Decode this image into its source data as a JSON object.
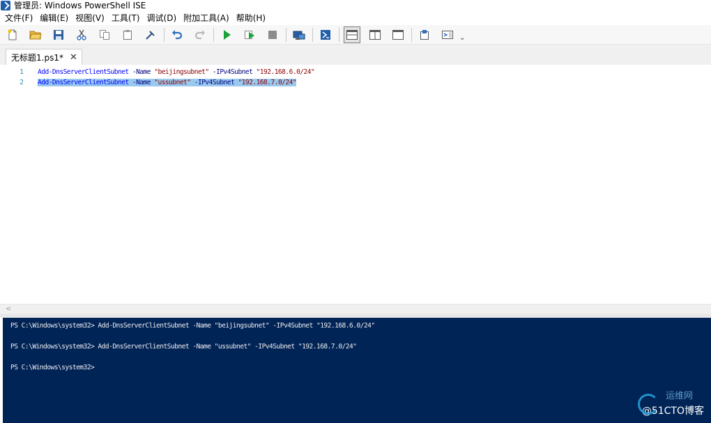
{
  "window": {
    "title": "管理员: Windows PowerShell ISE",
    "icon": "powershell-ise-icon"
  },
  "menu": [
    {
      "label": "文件(F)"
    },
    {
      "label": "编辑(E)"
    },
    {
      "label": "视图(V)"
    },
    {
      "label": "工具(T)"
    },
    {
      "label": "调试(D)"
    },
    {
      "label": "附加工具(A)"
    },
    {
      "label": "帮助(H)"
    }
  ],
  "toolbar": {
    "buttons": [
      {
        "icon": "new-file-icon"
      },
      {
        "icon": "open-folder-icon"
      },
      {
        "icon": "save-icon"
      },
      {
        "icon": "cut-icon"
      },
      {
        "icon": "copy-icon"
      },
      {
        "icon": "paste-icon"
      },
      {
        "icon": "clear-console-icon"
      },
      {
        "icon": "undo-icon"
      },
      {
        "icon": "redo-icon"
      },
      {
        "icon": "run-script-icon"
      },
      {
        "icon": "run-selection-icon"
      },
      {
        "icon": "stop-icon"
      },
      {
        "icon": "remote-powershell-icon"
      },
      {
        "icon": "powershell-console-icon"
      },
      {
        "icon": "layout-top-icon"
      },
      {
        "icon": "layout-right-icon"
      },
      {
        "icon": "layout-maximized-icon"
      },
      {
        "icon": "show-command-window-icon"
      },
      {
        "icon": "show-command-addon-icon"
      }
    ],
    "active_layout": "layout-top-icon",
    "more_glyph": "⌄"
  },
  "tabs": [
    {
      "label": "无标题1.ps1*",
      "close_glyph": "✕"
    }
  ],
  "editor": {
    "lines": [
      {
        "number": "1",
        "cmd": "Add-DnsServerClientSubnet",
        "p1": " -Name ",
        "s1": "\"beijingsubnet\"",
        "p2": " -IPv4Subnet ",
        "s2": "\"192.168.6.0/24\""
      },
      {
        "number": "2",
        "cmd": "Add-DnsServerClientSubnet",
        "p1": " -Name ",
        "s1": "\"ussubnet\"",
        "p2": " -IPv4Subnet ",
        "s2": "\"192.168.7.0/24\""
      }
    ],
    "selected_line": "2"
  },
  "hscroll": {
    "left_arrow": "<"
  },
  "console": {
    "lines": [
      "PS C:\\Windows\\system32> Add-DnsServerClientSubnet -Name \"beijingsubnet\" -IPv4Subnet \"192.168.6.0/24\"",
      "PS C:\\Windows\\system32> Add-DnsServerClientSubnet -Name \"ussubnet\" -IPv4Subnet \"192.168.7.0/24\"",
      "PS C:\\Windows\\system32>"
    ]
  },
  "watermark": {
    "top": "运维网",
    "text": "@51CTO博客"
  },
  "colors": {
    "console_bg": "#012456",
    "selection": "#99c9ef",
    "line_number": "#2b91af"
  }
}
